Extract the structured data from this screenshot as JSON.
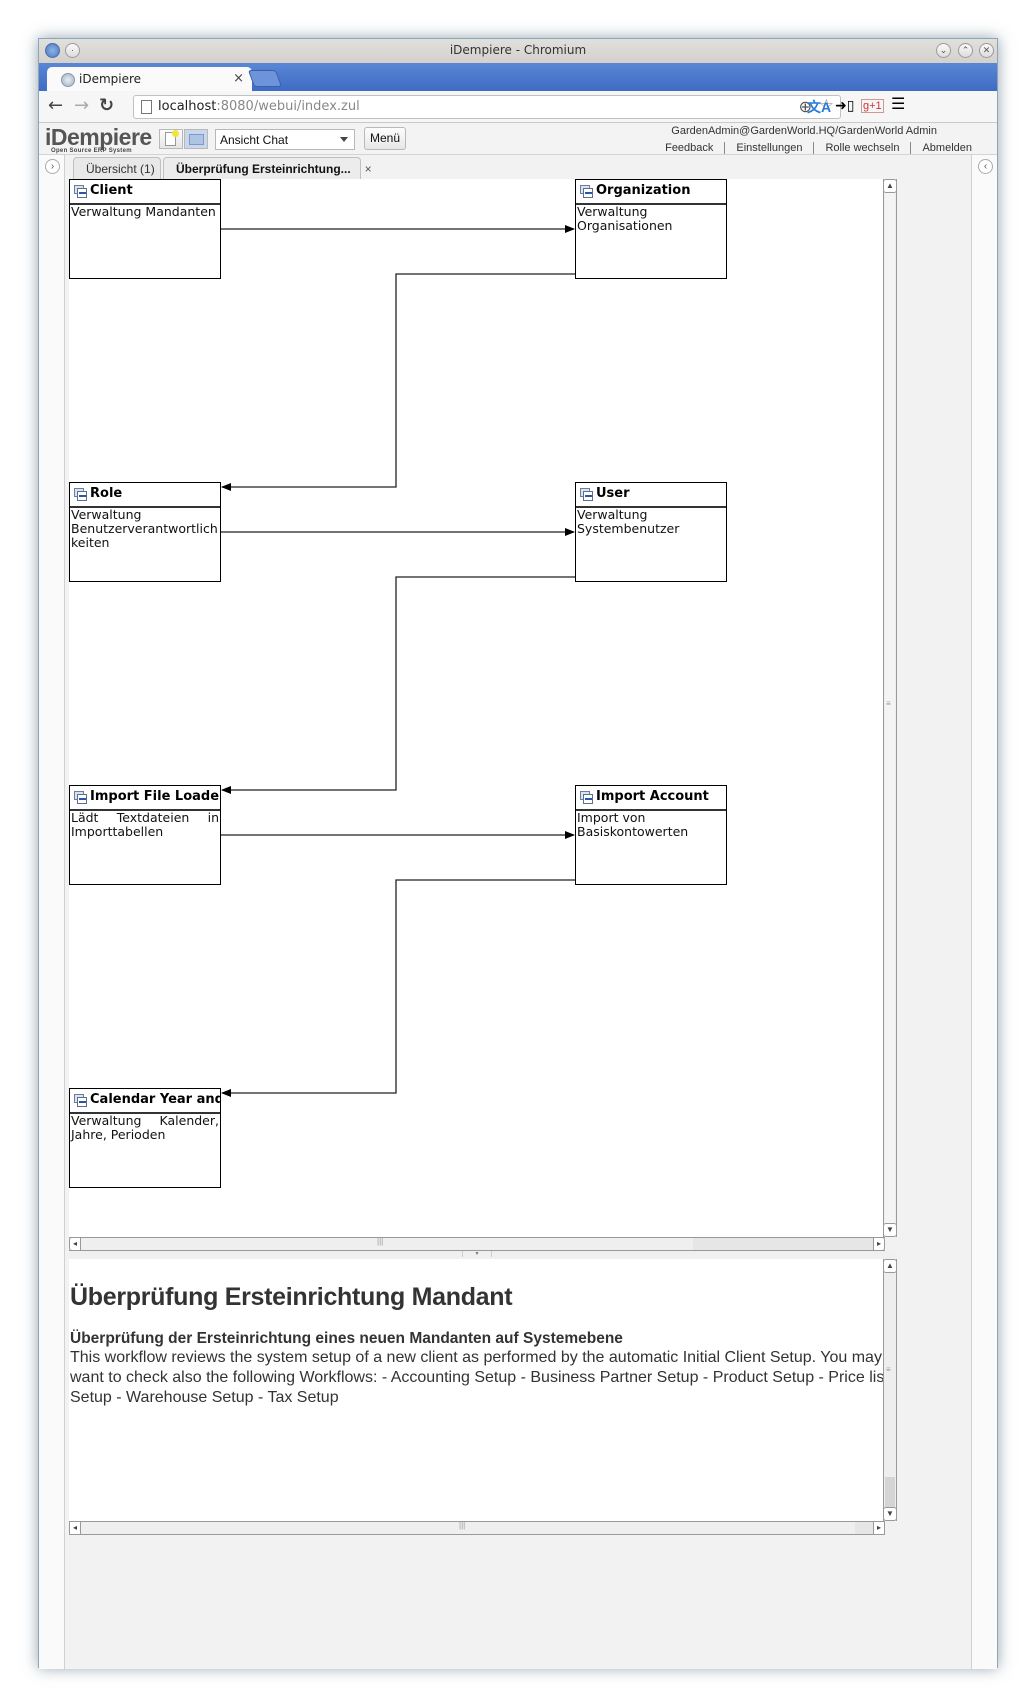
{
  "browser": {
    "window_title": "iDempiere - Chromium",
    "tab_title": "iDempiere",
    "url_host": "localhost",
    "url_rest": ":8080/webui/index.zul",
    "window_controls": [
      "minimize",
      "maximize",
      "close"
    ]
  },
  "app": {
    "logo_text": "iDempiere",
    "logo_subtitle": "Open Source  ERP System",
    "view_select": "Ansicht Chat",
    "menu_label": "Menü",
    "user_context": "GardenAdmin@GardenWorld.HQ/GardenWorld Admin",
    "header_links": [
      "Feedback",
      "Einstellungen",
      "Rolle wechseln",
      "Abmelden"
    ]
  },
  "tabs": [
    {
      "label": "Übersicht (1)",
      "active": false
    },
    {
      "label": "Überprüfung Ersteinrichtung...",
      "active": true,
      "closable": true
    }
  ],
  "workflow": {
    "nodes": [
      {
        "id": "client",
        "name": "Client",
        "description": "Verwaltung Mandanten",
        "justify": true
      },
      {
        "id": "organization",
        "name": "Organization",
        "description": "Verwaltung Organisationen",
        "justify": false
      },
      {
        "id": "role",
        "name": "Role",
        "description": "Verwaltung Benutzerverantwortlich keiten",
        "justify": false
      },
      {
        "id": "user",
        "name": "User",
        "description": "Verwaltung Systembenutzer",
        "justify": false
      },
      {
        "id": "import-file-loader",
        "name": "Import File Loader",
        "description": "Lädt Textdateien in Importtabellen",
        "justify": true
      },
      {
        "id": "import-account",
        "name": "Import Account",
        "description": "Import von Basiskontowerten",
        "justify": false
      },
      {
        "id": "calendar",
        "name": "Calendar Year and Period",
        "description": "Verwaltung Kalender, Jahre, Perioden",
        "justify": true
      }
    ],
    "transitions": [
      {
        "from": "client",
        "to": "organization"
      },
      {
        "from": "organization",
        "to": "role"
      },
      {
        "from": "role",
        "to": "user"
      },
      {
        "from": "user",
        "to": "import-file-loader"
      },
      {
        "from": "import-file-loader",
        "to": "import-account"
      },
      {
        "from": "import-account",
        "to": "calendar"
      }
    ]
  },
  "description": {
    "title": "Überprüfung Ersteinrichtung Mandant",
    "subtitle": "Überprüfung der Ersteinrichtung eines neuen Mandanten auf Systemebene",
    "body": "This workflow reviews the system setup of a new client as performed by the automatic Initial Client Setup. You may want to check also the following Workflows: - Accounting Setup - Business Partner Setup - Product Setup - Price list Setup - Warehouse Setup - Tax Setup"
  }
}
